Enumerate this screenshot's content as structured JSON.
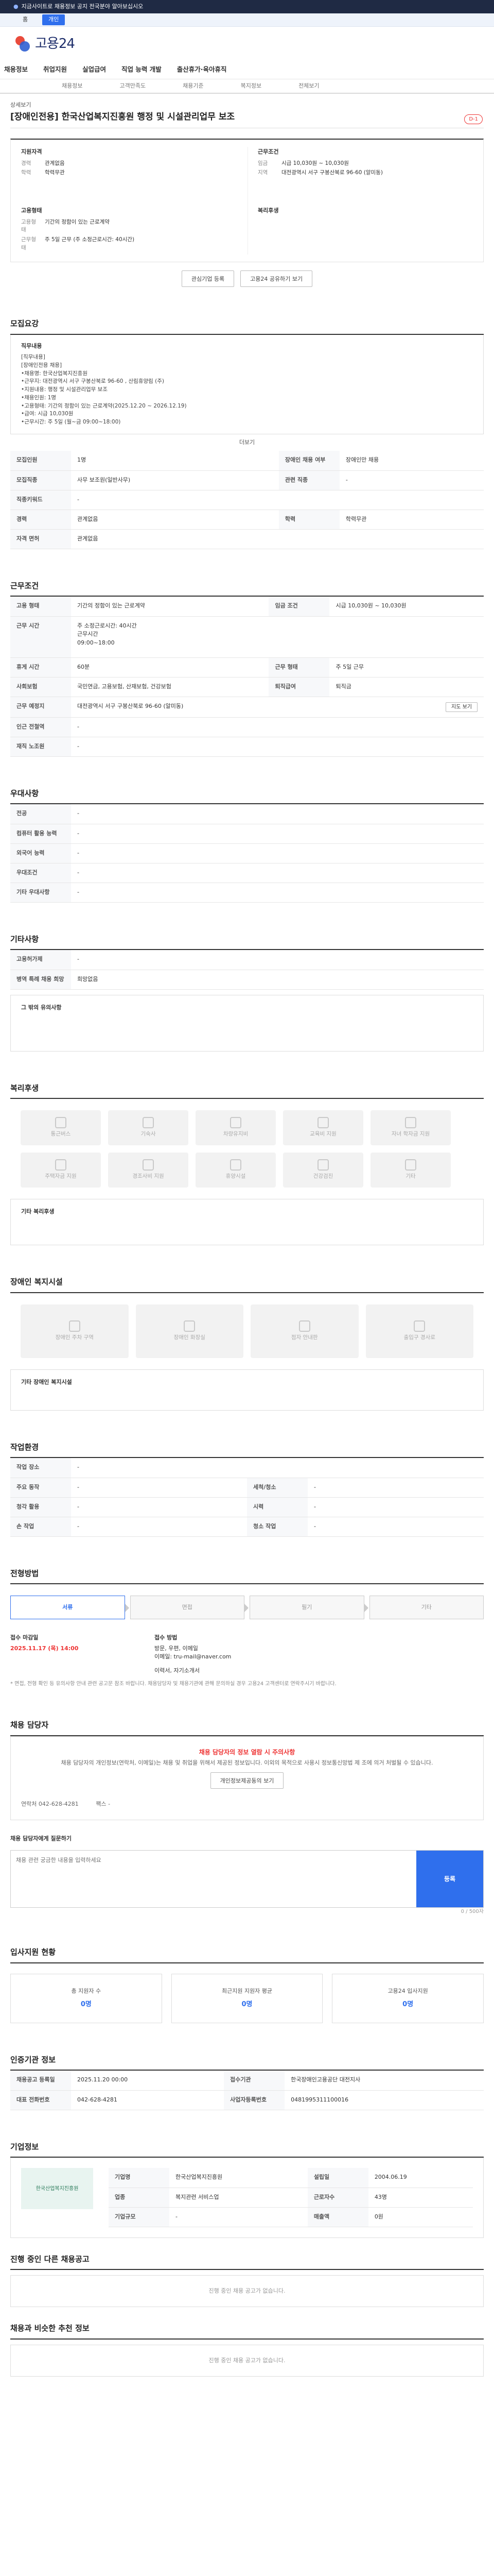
{
  "notice": {
    "text": "지금사이트로 채용정보 공지 전국분야 알아보십시오",
    "tab": "개인"
  },
  "brand": {
    "logo_text": "고용24"
  },
  "gnb": [
    "채용정보",
    "취업지원",
    "실업급여",
    "직업 능력 개발",
    "출산휴가·육아휴직"
  ],
  "subtabs": [
    "채용정보",
    "고객만족도",
    "채용기준",
    "복지정보",
    "전체보기"
  ],
  "job": {
    "pre": "상세보기",
    "title": "[장애인전용] 한국산업복지진흥원 행정 및 시설관리업무 보조",
    "badge": "D-1",
    "summary_left": {
      "title": "지원자격",
      "rows": [
        [
          "경력",
          "관계없음"
        ],
        [
          "학력",
          "학력무관"
        ]
      ]
    },
    "summary_right": {
      "title": "근무조건",
      "rows": [
        [
          "임금",
          "시급 10,030원 ~ 10,030원"
        ],
        [
          "지역",
          "대전광역시 서구 구봉산북로 96-60 (알미동)"
        ]
      ]
    },
    "summary_left2": {
      "title": "고용형태",
      "rows": [
        [
          "고용형태",
          "기간의 정함이 있는 근로계약"
        ],
        [
          "근무형태",
          "주 5일 근무 (주 소정근로시간: 40시간)"
        ]
      ]
    },
    "summary_right2": {
      "title": "복리후생",
      "rows": []
    },
    "btn_scrap": "관심기업 등록",
    "btn_share": "고용24 공유하기 보기"
  },
  "recruit": {
    "title": "모집요강",
    "desc_label": "직무내용",
    "desc": "[직무내용]\n[장애인전용 채용]\n•채용명: 한국산업복지진흥원\n•근무지: 대전광역시 서구 구봉산북로 96-60 , 산림휴양림 (주)\n•지원내용: 행정 및 시설관리업무 보조\n•채용인원: 1명\n•고용형태: 기간의 정함이 있는 근로계약(2025.12.20 ~ 2026.12.19)\n•급여: 시급 10,030원\n•근무시간: 주 5일 (월~금 09:00~18:00)",
    "more": "더보기",
    "rows": [
      [
        "모집인원",
        "1명",
        "장애인 채용 여부",
        "장애인만 채용"
      ],
      [
        "모집직종",
        "사무 보조원(일반사무)",
        "관련 직종",
        "-"
      ],
      [
        "직종키워드",
        "-",
        "",
        ""
      ],
      [
        "경력",
        "관계없음",
        "학력",
        "학력무관"
      ],
      [
        "자격 면허",
        "관계없음",
        "",
        ""
      ]
    ]
  },
  "work": {
    "title": "근무조건",
    "rows": [
      [
        "고용 형태",
        "기간의 정함이 있는 근로계약",
        "임금 조건",
        "시급 10,030원 ~ 10,030원"
      ],
      [
        "근무 시간",
        "주 소정근로시간: 40시간\n근무시간\n09:00~18:00",
        "",
        ""
      ],
      [
        "휴게 시간",
        "60분",
        "근무 형태",
        "주 5일 근무"
      ],
      [
        "사회보험",
        "국민연금, 고용보험, 산재보험, 건강보험",
        "퇴직급여",
        "퇴직금"
      ],
      [
        "근무 예정지",
        "대전광역시 서구 구봉산북로 96-60 (알미동)",
        "",
        ""
      ],
      [
        "인근 전철역",
        "-",
        "",
        ""
      ],
      [
        " 재직 노조원",
        "-",
        "",
        ""
      ]
    ],
    "map_btn": "지도 보기"
  },
  "pref": {
    "title": "우대사항",
    "rows": [
      [
        "전공",
        "-"
      ],
      [
        "컴퓨터 활용 능력",
        "-"
      ],
      [
        "외국어 능력",
        "-"
      ],
      [
        "우대조건",
        "-"
      ],
      [
        "기타 우대사항",
        "-"
      ]
    ]
  },
  "extra": {
    "title": "기타사항",
    "rows": [
      [
        "고용허가제",
        "-"
      ],
      [
        "병역 특례 채용 희망",
        "희망없음"
      ]
    ],
    "other_label": "그 밖의 유의사항"
  },
  "welfare": {
    "title": "복리후생",
    "items": [
      "통근버스",
      "기숙사",
      "차량유지비",
      "교육비 지원",
      "자녀 학자금 지원",
      "주택자금 지원",
      "경조사비 지원",
      "휴양시설",
      "건강검진",
      "기타"
    ],
    "etc_label": "기타 복리후생"
  },
  "disability": {
    "title": "장애인 복지시설",
    "items": [
      "장애인 주차 구역",
      "장애인 화장실",
      "점자 안내판",
      "출입구 경사로"
    ],
    "etc_label": "기타 장애인 복지시설"
  },
  "env": {
    "title": "작업환경",
    "rows": [
      [
        "작업 장소",
        "-",
        "",
        ""
      ],
      [
        "주요 동작",
        "-",
        "세척/청소",
        "-"
      ],
      [
        "청각 활용",
        "-",
        "시력",
        "-"
      ],
      [
        "손 작업",
        "-",
        "청소 작업",
        "-"
      ]
    ]
  },
  "process": {
    "title": "전형방법",
    "steps": [
      "서류",
      "면접",
      "필기",
      "기타"
    ],
    "deadline_label": "접수 마감일",
    "deadline": "2025.11.17 (목) 14:00",
    "method_label": "접수 방법",
    "method": "방문, 우편, 이메일",
    "email": "이메일: tru-mail@naver.com",
    "docs": "이력서, 자기소개서",
    "note": "* 면접, 전형 확인 등 유의사항 안내 관련 공고문 참조 바랍니다. 채용담당자 및 채용기관에 관해 문의하실 경우 고용24 고객센터로 연락주시기 바랍니다."
  },
  "contact": {
    "title": "채용 담당자",
    "alert_title": "채용 담당자의 정보 열람 시 주의사항",
    "alert_body": "채용 담당자의 개인정보(연락처, 이메일)는 채용 및 취업을 위해서 제공된 정보입니다. 이외의 목적으로 사용시 정보통신망법 제 조에 의거 처벌될 수 있습니다.",
    "alert_btn": "개인정보제공동의 보기",
    "phone_label": "연락처",
    "phone": "042-628-4281",
    "fax_label": "팩스",
    "fax": "-",
    "qa_title": "채용 담당자에게 질문하기",
    "qa_placeholder": "채용 관련 궁금한 내용을 입력하세요",
    "qa_btn": "등록",
    "qa_count": "0 / 500자"
  },
  "apply_status": {
    "title": "입사지원 현황",
    "items": [
      [
        "총 지원자 수",
        "0명"
      ],
      [
        "최근지원 지원자 평균",
        "0명"
      ],
      [
        "고용24 입사지원",
        "0명"
      ]
    ]
  },
  "agency": {
    "title": "인증기관 정보",
    "rows": [
      [
        "채용공고 등록일",
        "2025.11.20 00:00",
        "접수기관",
        "한국장애인고용공단 대전지사"
      ],
      [
        "대표 전화번호",
        "042-628-4281",
        "사업자등록번호",
        "0481995311100016"
      ]
    ]
  },
  "company": {
    "title": "기업정보",
    "name": "한국산업복지진흥원",
    "rows": [
      [
        "기업명",
        "한국산업복지진흥원",
        "설립일",
        "2004.06.19"
      ],
      [
        "업종",
        "복지관련 서비스업",
        "근로자수",
        "43명"
      ],
      [
        "기업규모",
        "-",
        "매출액",
        "0원"
      ]
    ]
  },
  "same_co": {
    "title": "진행 중인 다른 채용공고",
    "empty": "진행 중인 채용 공고가 없습니다."
  },
  "recommend": {
    "title": "채용과 비슷한 추천 정보",
    "empty": "진행 중인 채용 공고가 없습니다."
  }
}
